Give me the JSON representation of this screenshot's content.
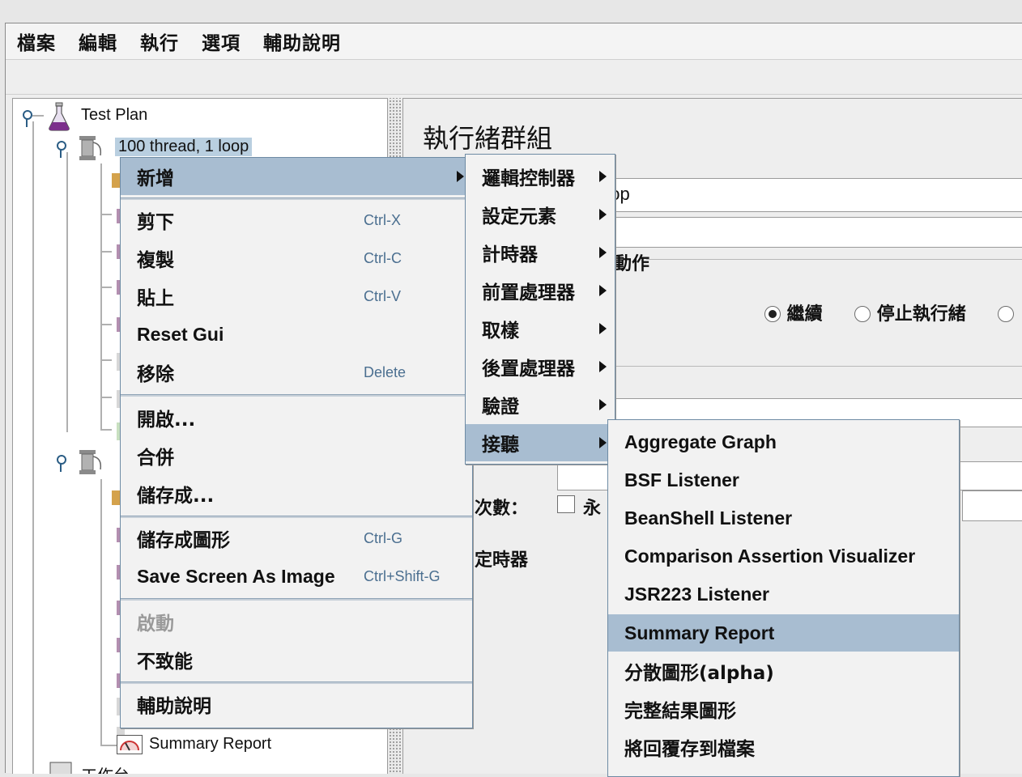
{
  "menubar": {
    "items": [
      "檔案",
      "編輯",
      "執行",
      "選項",
      "輔助說明"
    ]
  },
  "tree": {
    "test_plan": "Test Plan",
    "thread_group": "100 thread, 1 loop",
    "summary_report": "Summary Report",
    "workbench_partial": "工作台"
  },
  "right_panel": {
    "title": "執行緒群組",
    "name_value_partial": "oop",
    "action_label_partial": "動作",
    "radio_continue": "繼續",
    "radio_stop_thread": "停止執行緒",
    "loop_label_partial": "次數：",
    "forever_partial": "永",
    "scheduler_partial": "定時器"
  },
  "context_menu": {
    "add": "新增",
    "cut": "剪下",
    "cut_sc": "Ctrl-X",
    "copy": "複製",
    "copy_sc": "Ctrl-C",
    "paste": "貼上",
    "paste_sc": "Ctrl-V",
    "reset_gui": "Reset Gui",
    "remove": "移除",
    "remove_sc": "Delete",
    "open": "開啟...",
    "merge": "合併",
    "save_as": "儲存成...",
    "save_as_image": "儲存成圖形",
    "save_as_image_sc": "Ctrl-G",
    "save_screen": "Save Screen As Image",
    "save_screen_sc": "Ctrl+Shift-G",
    "enable": "啟動",
    "disable": "不致能",
    "help": "輔助說明"
  },
  "add_submenu": {
    "items": [
      "邏輯控制器",
      "設定元素",
      "計時器",
      "前置處理器",
      "取樣",
      "後置處理器",
      "驗證",
      "接聽"
    ]
  },
  "listener_submenu": {
    "items": [
      "Aggregate Graph",
      "BSF Listener",
      "BeanShell Listener",
      "Comparison Assertion Visualizer",
      "JSR223 Listener",
      "Summary Report",
      "分散圖形(alpha)",
      "完整結果圖形",
      "將回覆存到檔案"
    ]
  }
}
